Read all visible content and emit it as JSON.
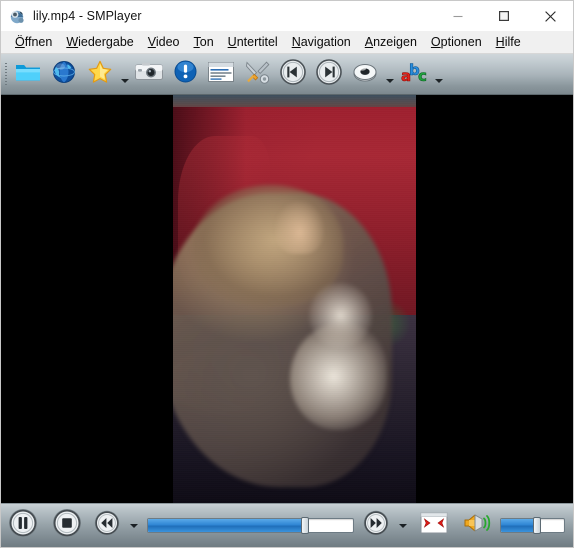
{
  "window": {
    "title": "lily.mp4 - SMPlayer",
    "app_icon": "smplayer-icon",
    "controls": {
      "minimize_label": "Minimize",
      "maximize_label": "Maximize",
      "close_label": "Close"
    }
  },
  "menubar": {
    "items": [
      {
        "label": "Öffnen",
        "accel": "Ö",
        "rest": "ffnen"
      },
      {
        "label": "Wiedergabe",
        "accel": "W",
        "rest": "iedergabe"
      },
      {
        "label": "Video",
        "accel": "V",
        "rest": "ideo"
      },
      {
        "label": "Ton",
        "accel": "T",
        "rest": "on"
      },
      {
        "label": "Untertitel",
        "accel": "U",
        "rest": "ntertitel"
      },
      {
        "label": "Navigation",
        "accel": "N",
        "rest": "avigation"
      },
      {
        "label": "Anzeigen",
        "accel": "A",
        "rest": "nzeigen"
      },
      {
        "label": "Optionen",
        "accel": "O",
        "rest": "ptionen"
      },
      {
        "label": "Hilfe",
        "accel": "H",
        "rest": "ilfe"
      }
    ]
  },
  "toolbar": {
    "buttons": [
      {
        "name": "open-file-button",
        "icon": "folder-icon",
        "tooltip": "Datei öffnen"
      },
      {
        "name": "open-url-button",
        "icon": "globe-icon",
        "tooltip": "URL öffnen"
      },
      {
        "name": "favorites-button",
        "icon": "star-icon",
        "tooltip": "Favoriten",
        "has_menu": true
      },
      {
        "name": "screenshot-button",
        "icon": "camera-icon",
        "tooltip": "Bildschirmfoto"
      },
      {
        "name": "media-info-button",
        "icon": "info-icon",
        "tooltip": "Informationen"
      },
      {
        "name": "playlist-button",
        "icon": "playlist-icon",
        "tooltip": "Wiedergabeliste"
      },
      {
        "name": "preferences-button",
        "icon": "tools-icon",
        "tooltip": "Einstellungen"
      },
      {
        "name": "previous-button",
        "icon": "skip-previous-icon",
        "tooltip": "Vorheriger"
      },
      {
        "name": "next-button",
        "icon": "skip-next-icon",
        "tooltip": "Nächster"
      },
      {
        "name": "audio-track-button",
        "icon": "audio-disc-icon",
        "tooltip": "Tonspur",
        "has_menu": true
      },
      {
        "name": "subtitles-button",
        "icon": "abc-subtitle-icon",
        "tooltip": "Untertitel",
        "has_menu": true
      }
    ]
  },
  "video": {
    "file_name": "lily.mp4",
    "scene_description": "Fluffy tabby cat lying on a red couch",
    "letterbox_color": "#000000",
    "aspect": "portrait"
  },
  "controlbar": {
    "pause_button": {
      "name": "pause-button",
      "icon": "pause-icon",
      "tooltip": "Pause"
    },
    "stop_button": {
      "name": "stop-button",
      "icon": "stop-icon",
      "tooltip": "Stopp"
    },
    "rewind_button": {
      "name": "rewind-button",
      "icon": "rewind-icon",
      "tooltip": "Zurückspulen",
      "has_menu": true
    },
    "forward_button": {
      "name": "forward-button",
      "icon": "fast-forward-icon",
      "tooltip": "Vorspulen",
      "has_menu": true
    },
    "fullscreen_button": {
      "name": "fullscreen-button",
      "icon": "fullscreen-icon",
      "tooltip": "Vollbild"
    },
    "mute_button": {
      "name": "mute-button",
      "icon": "speaker-volume-icon",
      "tooltip": "Stumm"
    },
    "seek_slider": {
      "name": "seek-slider",
      "value_percent": 76,
      "min": 0,
      "max": 100
    },
    "volume_slider": {
      "name": "volume-slider",
      "value_percent": 56,
      "min": 0,
      "max": 100
    }
  },
  "colors": {
    "accent_blue": "#2f86d4",
    "toolbar_top": "#cfd6da",
    "toolbar_bottom": "#7c888e",
    "titlebar_bg": "#ffffff",
    "menubar_bg": "#f0f0f0",
    "video_bg": "#000000"
  }
}
